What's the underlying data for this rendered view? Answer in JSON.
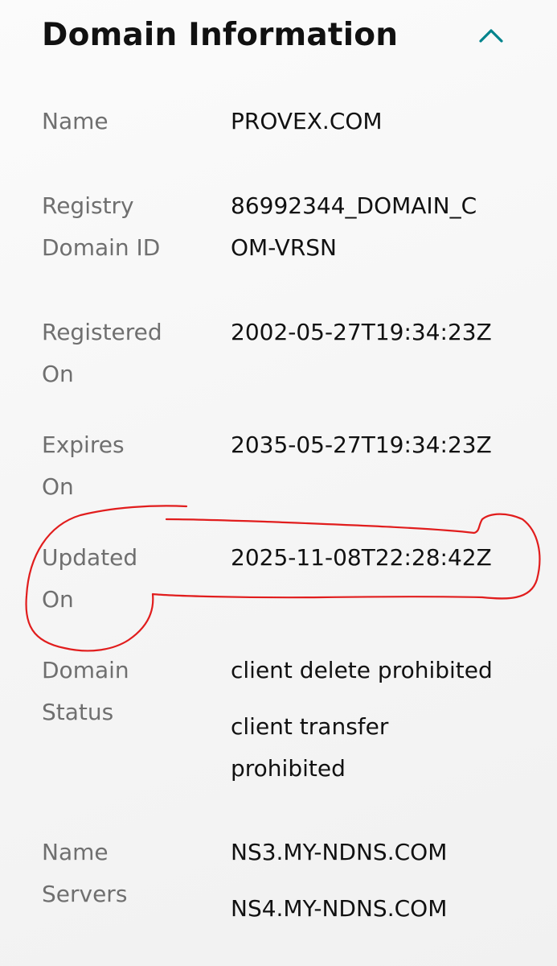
{
  "section": {
    "title": "Domain Information",
    "collapse_icon": "chevron-up-icon",
    "accent_color": "#00838c"
  },
  "rows": [
    {
      "label": [
        "Name"
      ],
      "values": [
        "PROVEX.COM"
      ]
    },
    {
      "label": [
        "Registry",
        "Domain ID"
      ],
      "values": [
        "86992344_DOMAIN_C",
        "OM-VRSN"
      ]
    },
    {
      "label": [
        "Registered",
        "On"
      ],
      "values": [
        "2002-05-27T19:34:23Z"
      ]
    },
    {
      "label": [
        "Expires",
        "On"
      ],
      "values": [
        "2035-05-27T19:34:23Z"
      ]
    },
    {
      "label": [
        "Updated",
        "On"
      ],
      "values": [
        "2025-11-08T22:28:42Z"
      ]
    },
    {
      "label": [
        "Domain",
        "Status"
      ],
      "values": [
        "client delete prohibited",
        "client transfer",
        "prohibited"
      ]
    },
    {
      "label": [
        "Name",
        "Servers"
      ],
      "values": [
        "NS3.MY-NDNS.COM",
        "NS4.MY-NDNS.COM"
      ]
    }
  ],
  "annotation": {
    "color": "#e11d1d"
  }
}
